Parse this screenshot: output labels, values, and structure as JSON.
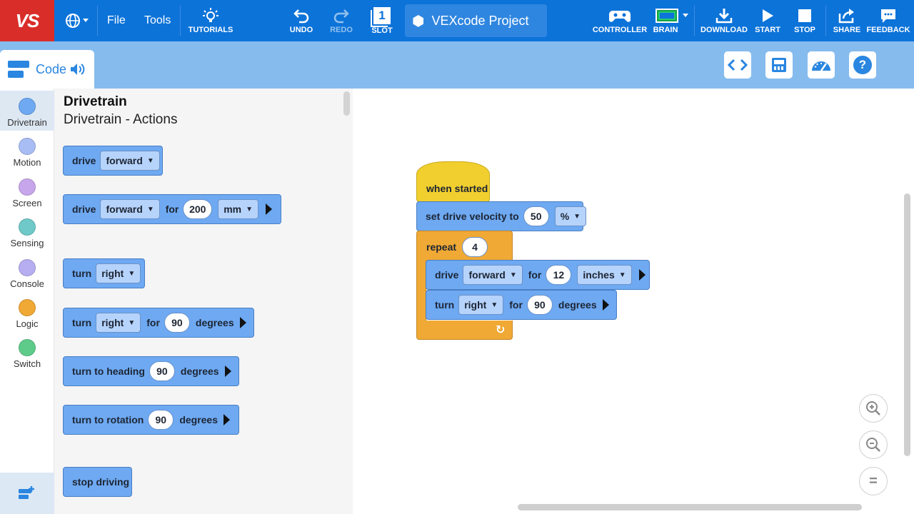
{
  "topbar": {
    "logo": "VS",
    "menu_file": "File",
    "menu_tools": "Tools",
    "tutorials": "TUTORIALS",
    "undo": "UNDO",
    "redo": "REDO",
    "slot": "SLOT",
    "slot_number": "1",
    "project_name": "VEXcode Project",
    "controller": "CONTROLLER",
    "brain": "BRAIN",
    "download": "DOWNLOAD",
    "start": "START",
    "stop": "STOP",
    "share": "SHARE",
    "feedback": "FEEDBACK",
    "brand_red": "#d92d2a",
    "bar_blue": "#0c73d9"
  },
  "subbar": {
    "code_tab": "Code",
    "buttons": [
      "code-view-icon",
      "devices-icon",
      "dashboard-icon",
      "help-icon"
    ],
    "help_glyph": "?"
  },
  "categories": [
    {
      "label": "Drivetrain",
      "color": "#6ea9f2"
    },
    {
      "label": "Motion",
      "color": "#a9bdf5"
    },
    {
      "label": "Screen",
      "color": "#c7a6ec"
    },
    {
      "label": "Sensing",
      "color": "#6fc9c9"
    },
    {
      "label": "Console",
      "color": "#b6aef0"
    },
    {
      "label": "Logic",
      "color": "#f0a935"
    },
    {
      "label": "Switch",
      "color": "#5fcb8b"
    }
  ],
  "flyout": {
    "title": "Drivetrain",
    "subtitle": "Drivetrain - Actions",
    "b1": {
      "t": "drive",
      "dd": "forward"
    },
    "b2": {
      "t": "drive",
      "dd": "forward",
      "for": "for",
      "num": "200",
      "unit": "mm"
    },
    "b3": {
      "t": "turn",
      "dd": "right"
    },
    "b4": {
      "t": "turn",
      "dd": "right",
      "for": "for",
      "num": "90",
      "unit": "degrees"
    },
    "b5": {
      "t": "turn to heading",
      "num": "90",
      "unit": "degrees"
    },
    "b6": {
      "t": "turn to rotation",
      "num": "90",
      "unit": "degrees"
    },
    "b7": {
      "t": "stop driving"
    }
  },
  "canvas": {
    "hat": "when started",
    "velocity": {
      "t": "set drive velocity to",
      "num": "50",
      "unit": "%"
    },
    "repeat": {
      "t": "repeat",
      "num": "4"
    },
    "drive": {
      "t": "drive",
      "dd": "forward",
      "for": "for",
      "num": "12",
      "unit": "inches"
    },
    "turn": {
      "t": "turn",
      "dd": "right",
      "for": "for",
      "num": "90",
      "unit": "degrees"
    },
    "loop_glyph": "↻"
  },
  "zoom": {
    "in": "zoom-in-icon",
    "out": "zoom-out-icon",
    "reset": "zoom-reset-icon",
    "reset_glyph": "="
  }
}
